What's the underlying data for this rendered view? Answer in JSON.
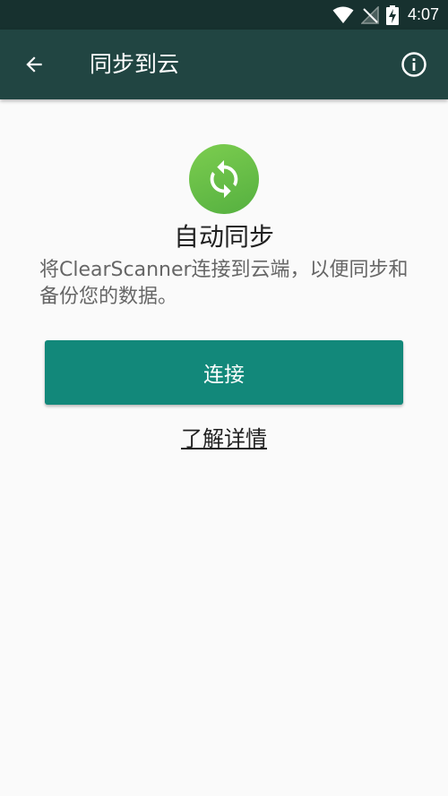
{
  "status_bar": {
    "time": "4:07",
    "icons": [
      "wifi-icon",
      "no-signal-icon",
      "battery-charging-icon"
    ]
  },
  "app_bar": {
    "title": "同步到云",
    "back_icon": "arrow-back-icon",
    "info_icon": "info-icon"
  },
  "content": {
    "logo_icon": "sync-icon",
    "heading": "自动同步",
    "description": "将ClearScanner连接到云端，以便同步和备份您的数据。",
    "connect_label": "连接",
    "learn_more_label": "了解详情"
  },
  "colors": {
    "status_bar": "#17312f",
    "app_bar": "#214542",
    "accent": "#12887a",
    "logo_green": "#5cb944",
    "background": "#fafafa"
  }
}
